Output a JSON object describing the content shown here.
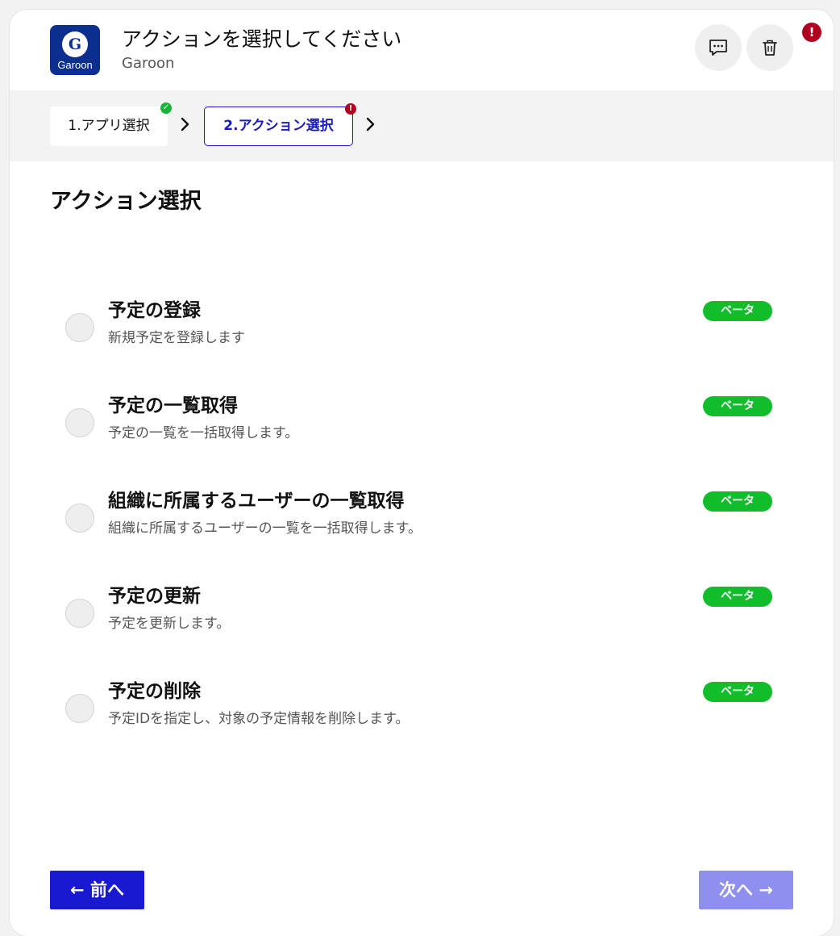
{
  "header": {
    "title": "アクションを選択してください",
    "subtitle": "Garoon",
    "logo_letter": "G",
    "logo_text": "Garoon",
    "alert_mark": "!"
  },
  "icons": {
    "comment": "comment-icon",
    "trash": "trash-icon",
    "chevron": "chevron-right-icon"
  },
  "steps": [
    {
      "label": "1.アプリ選択",
      "status": "complete",
      "mark": "✓"
    },
    {
      "label": "2.アクション選択",
      "status": "error",
      "mark": "!"
    }
  ],
  "section_title": "アクション選択",
  "actions": [
    {
      "name": "予定の登録",
      "description": "新規予定を登録します",
      "badge": "ベータ"
    },
    {
      "name": "予定の一覧取得",
      "description": "予定の一覧を一括取得します。",
      "badge": "ベータ"
    },
    {
      "name": "組織に所属するユーザーの一覧取得",
      "description": "組織に所属するユーザーの一覧を一括取得します。",
      "badge": "ベータ"
    },
    {
      "name": "予定の更新",
      "description": "予定を更新します。",
      "badge": "ベータ"
    },
    {
      "name": "予定の削除",
      "description": "予定IDを指定し、対象の予定情報を削除します。",
      "badge": "ベータ"
    }
  ],
  "footer": {
    "prev_label": "← 前へ",
    "next_label": "次へ →"
  },
  "colors": {
    "primary": "#1919d2",
    "primary_disabled": "#8f8ff0",
    "beta_badge": "#12bd2c",
    "error": "#b00020",
    "success": "#17b43a",
    "logo_bg": "#0b2f8f"
  }
}
